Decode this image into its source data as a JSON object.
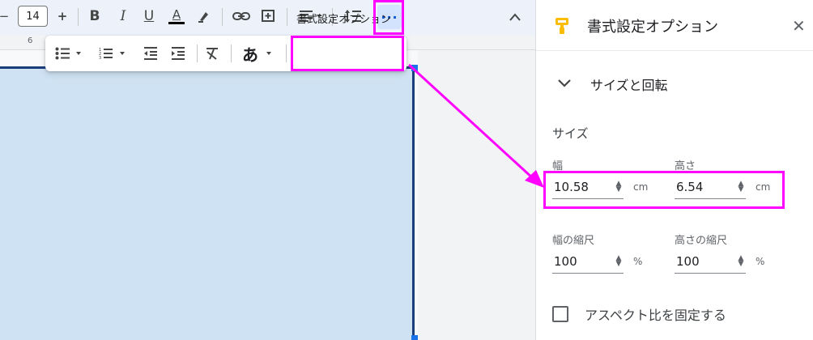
{
  "toolbar": {
    "font_size": "14",
    "minus": "−",
    "plus": "+",
    "bold": "B",
    "italic": "I",
    "underline": "U",
    "text_color": "A",
    "more_label": "···"
  },
  "ruler": {
    "tick": "6"
  },
  "popup": {
    "label": "書式設定オプション",
    "text_style_glyph": "あ"
  },
  "panel": {
    "title": "書式設定オプション",
    "close": "✕",
    "section_title": "サイズと回転",
    "size_heading": "サイズ",
    "width_label": "幅",
    "width_value": "10.58",
    "width_unit": "cm",
    "height_label": "高さ",
    "height_value": "6.54",
    "height_unit": "cm",
    "width_scale_label": "幅の縮尺",
    "width_scale_value": "100",
    "width_scale_unit": "%",
    "height_scale_label": "高さの縮尺",
    "height_scale_value": "100",
    "height_scale_unit": "%",
    "lock_aspect_label": "アスペクト比を固定する"
  },
  "colors": {
    "highlight": "#ff00ff",
    "image_fill": "#cfe2f3",
    "accent": "#1a73e8",
    "panel_icon": "#fbbc04"
  },
  "icons": [
    "link-icon",
    "comment-icon",
    "align-icon",
    "line-spacing-icon",
    "bullet-list-icon",
    "numbered-list-icon",
    "decrease-indent-icon",
    "increase-indent-icon",
    "clear-format-icon",
    "paint-format-icon"
  ]
}
